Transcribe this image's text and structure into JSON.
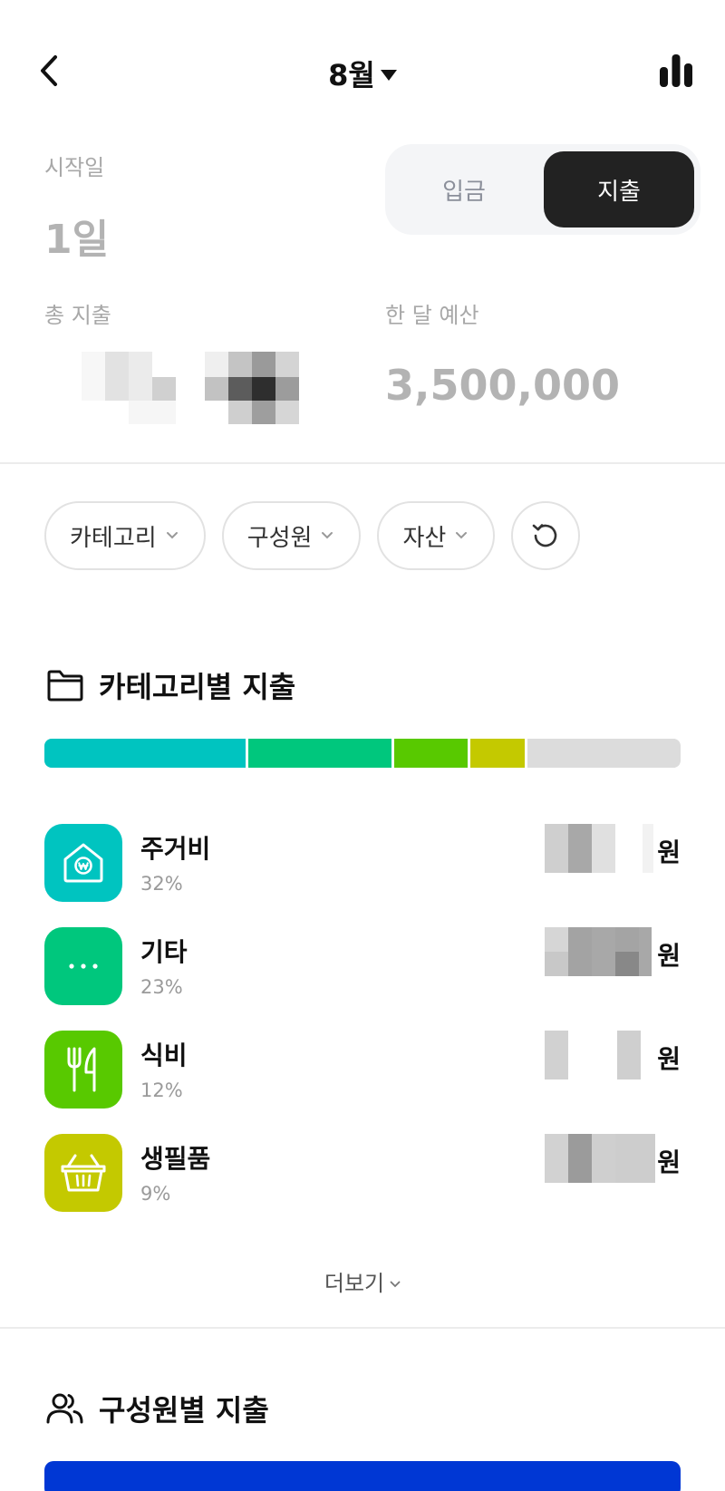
{
  "header": {
    "month": "8월"
  },
  "start": {
    "label": "시작일",
    "value": "1일"
  },
  "toggle": {
    "income": "입금",
    "expense": "지출",
    "selected": "expense"
  },
  "total": {
    "label": "총 지출"
  },
  "budget": {
    "label": "한 달 예산",
    "value": "3,500,000"
  },
  "filters": [
    {
      "label": "카테고리"
    },
    {
      "label": "구성원"
    },
    {
      "label": "자산"
    }
  ],
  "category_section": {
    "title": "카테고리별 지출"
  },
  "category_bar": [
    {
      "color": "#00c4c0",
      "share": 0.32
    },
    {
      "color": "#00c77d",
      "share": 0.23
    },
    {
      "color": "#58c900",
      "share": 0.12
    },
    {
      "color": "#c4c900",
      "share": 0.09
    },
    {
      "color": "#dcdcdc",
      "share": 0.24
    }
  ],
  "categories": [
    {
      "name": "주거비",
      "percent": "32%",
      "currency": "원",
      "color": "#00c4c0",
      "icon": "house-icon"
    },
    {
      "name": "기타",
      "percent": "23%",
      "currency": "원",
      "color": "#00c77d",
      "icon": "more-dots-icon"
    },
    {
      "name": "식비",
      "percent": "12%",
      "currency": "원",
      "color": "#58c900",
      "icon": "fork-knife-icon"
    },
    {
      "name": "생필품",
      "percent": "9%",
      "currency": "원",
      "color": "#c4c900",
      "icon": "basket-icon"
    }
  ],
  "more": {
    "label": "더보기"
  },
  "member_section": {
    "title": "구성원별 지출",
    "bar_color": "#0037d4"
  }
}
